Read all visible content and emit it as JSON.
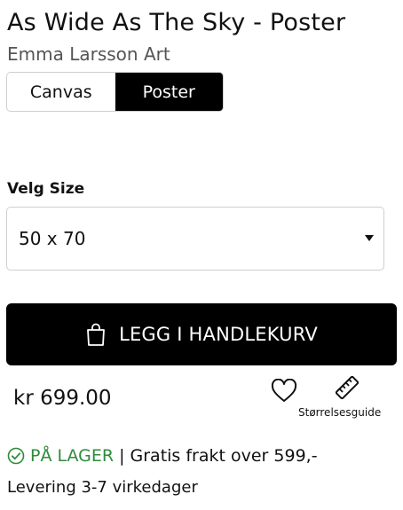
{
  "product": {
    "title": "As Wide As The Sky - Poster",
    "artist": "Emma Larsson Art"
  },
  "format_toggle": {
    "options": [
      {
        "label": "Canvas",
        "selected": false
      },
      {
        "label": "Poster",
        "selected": true
      }
    ]
  },
  "size": {
    "label": "Velg Size",
    "selected": "50 x 70"
  },
  "cart": {
    "button_label": "LEGG I HANDLEKURV",
    "icon": "shopping-bag-icon"
  },
  "price": "kr 699.00",
  "actions": {
    "wishlist_icon": "heart-icon",
    "size_guide_icon": "ruler-icon",
    "size_guide_label": "Størrelsesguide"
  },
  "availability": {
    "status": "PÅ LAGER",
    "separator": "|",
    "shipping": "Gratis frakt over 599,-",
    "delivery": "Levering 3-7 virkedager",
    "status_color": "#2e8b3a"
  }
}
